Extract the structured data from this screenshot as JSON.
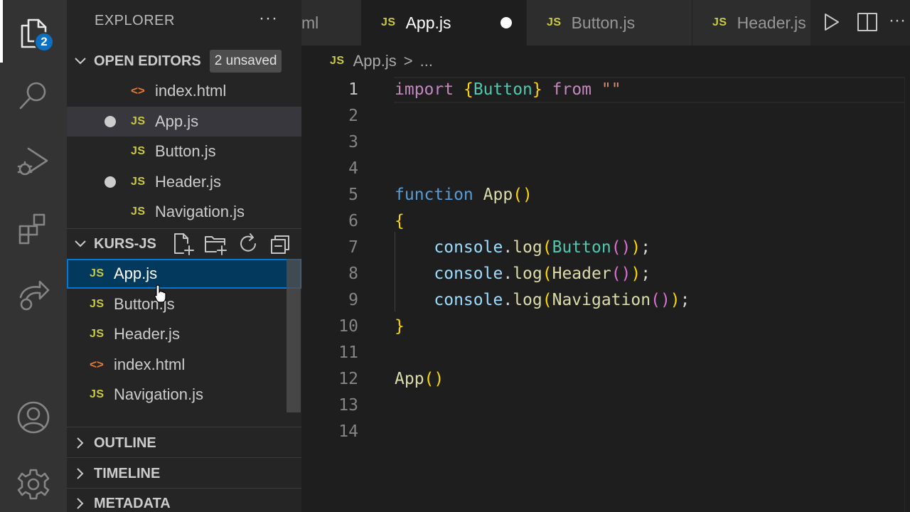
{
  "activity_bar": {
    "explorer_badge": "2",
    "items": [
      "files-icon",
      "search-icon",
      "run-debug-icon",
      "extensions-icon",
      "live-share-icon",
      "account-icon",
      "gear-icon"
    ]
  },
  "sidebar": {
    "title": "EXPLORER",
    "more": "···",
    "open_editors": {
      "label": "OPEN EDITORS",
      "unsaved": "2 unsaved",
      "items": [
        {
          "name": "index.html",
          "icon": "<>",
          "dirty": false
        },
        {
          "name": "App.js",
          "icon": "JS",
          "dirty": true
        },
        {
          "name": "Button.js",
          "icon": "JS",
          "dirty": false
        },
        {
          "name": "Header.js",
          "icon": "JS",
          "dirty": true
        },
        {
          "name": "Navigation.js",
          "icon": "JS",
          "dirty": false
        }
      ]
    },
    "folder": {
      "label": "KURS-JS",
      "files": [
        {
          "name": "App.js",
          "icon": "JS"
        },
        {
          "name": "Button.js",
          "icon": "JS"
        },
        {
          "name": "Header.js",
          "icon": "JS"
        },
        {
          "name": "index.html",
          "icon": "<>"
        },
        {
          "name": "Navigation.js",
          "icon": "JS"
        }
      ]
    },
    "outline": "OUTLINE",
    "timeline": "TIMELINE",
    "metadata": "METADATA"
  },
  "tabs": [
    {
      "label": "ml",
      "icon": ""
    },
    {
      "label": "App.js",
      "icon": "JS",
      "active": true,
      "dirty": true
    },
    {
      "label": "Button.js",
      "icon": "JS"
    },
    {
      "label": "Header.js",
      "icon": "JS"
    }
  ],
  "breadcrumb": {
    "icon": "JS",
    "file": "App.js",
    "sep": ">",
    "rest": "..."
  },
  "editor": {
    "line_numbers": [
      "1",
      "2",
      "3",
      "4",
      "5",
      "6",
      "7",
      "8",
      "9",
      "10",
      "11",
      "12",
      "13",
      "14"
    ],
    "current_line": "1",
    "lines": [
      "import {Button} from \"\"",
      "",
      "",
      "",
      "function App()",
      "{",
      "    console.log(Button());",
      "    console.log(Header());",
      "    console.log(Navigation());",
      "}",
      "",
      "App()",
      "",
      ""
    ]
  },
  "colors": {
    "accent": "#0078d4",
    "badge": "#0e70c0",
    "js_icon": "#cbcb41",
    "html_icon": "#e37933"
  }
}
